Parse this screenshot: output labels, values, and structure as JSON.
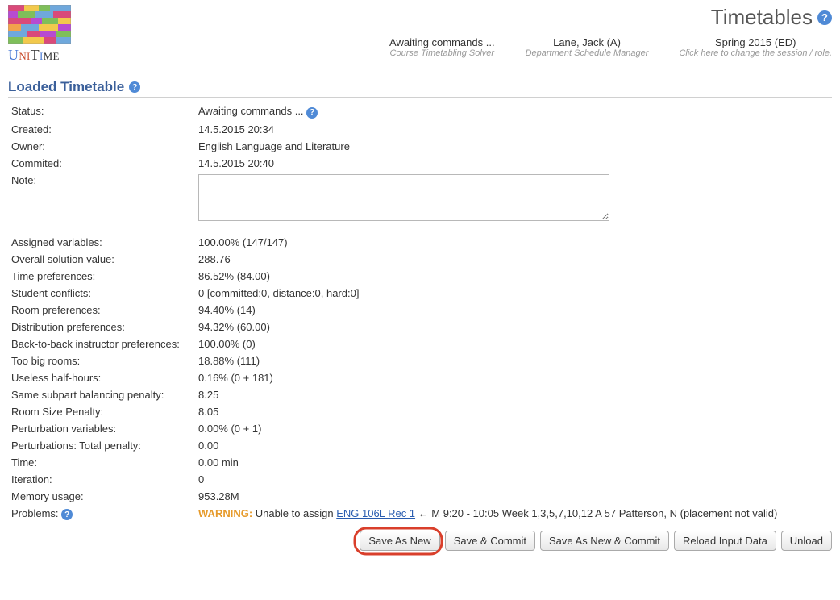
{
  "header": {
    "page_title": "Timetables",
    "logo_text": "UniTime",
    "session": {
      "item1_line1": "Awaiting commands ...",
      "item1_line2": "Course Timetabling Solver",
      "item2_line1": "Lane, Jack (A)",
      "item2_line2": "Department Schedule Manager",
      "item3_line1": "Spring 2015 (ED)",
      "item3_line2": "Click here to change the session / role."
    }
  },
  "section_title": "Loaded Timetable",
  "props": {
    "status_label": "Status:",
    "status_value": "Awaiting commands ...",
    "created_label": "Created:",
    "created_value": "14.5.2015 20:34",
    "owner_label": "Owner:",
    "owner_value": "English Language and Literature",
    "committed_label": "Commited:",
    "committed_value": "14.5.2015 20:40",
    "note_label": "Note:",
    "note_value": "",
    "assigned_label": "Assigned variables:",
    "assigned_value": "100.00% (147/147)",
    "overall_label": "Overall solution value:",
    "overall_value": "288.76",
    "timepref_label": "Time preferences:",
    "timepref_value": "86.52% (84.00)",
    "stuconf_label": "Student conflicts:",
    "stuconf_value": "0 [committed:0, distance:0, hard:0]",
    "roompref_label": "Room preferences:",
    "roompref_value": "94.40% (14)",
    "distpref_label": "Distribution preferences:",
    "distpref_value": "94.32% (60.00)",
    "btb_label": "Back-to-back instructor preferences:",
    "btb_value": "100.00% (0)",
    "toobig_label": "Too big rooms:",
    "toobig_value": "18.88% (111)",
    "useless_label": "Useless half-hours:",
    "useless_value": "0.16% (0 + 181)",
    "balance_label": "Same subpart balancing penalty:",
    "balance_value": "8.25",
    "roomsize_label": "Room Size Penalty:",
    "roomsize_value": "8.05",
    "pertvar_label": "Perturbation variables:",
    "pertvar_value": "0.00% (0 + 1)",
    "perttot_label": "Perturbations: Total penalty:",
    "perttot_value": "0.00",
    "time_label": "Time:",
    "time_value": "0.00 min",
    "iter_label": "Iteration:",
    "iter_value": "0",
    "mem_label": "Memory usage:",
    "mem_value": "953.28M",
    "problems_label": "Problems:",
    "problems_warn": "WARNING:",
    "problems_pre": " Unable to assign ",
    "problems_link": "ENG 106L Rec 1",
    "problems_post": " ← M 9:20 - 10:05 Week 1,3,5,7,10,12 A 57 Patterson, N (placement not valid)"
  },
  "buttons": {
    "save_as_new": "Save As New",
    "save_commit": "Save & Commit",
    "save_new_commit": "Save As New & Commit",
    "reload": "Reload Input Data",
    "unload": "Unload"
  }
}
